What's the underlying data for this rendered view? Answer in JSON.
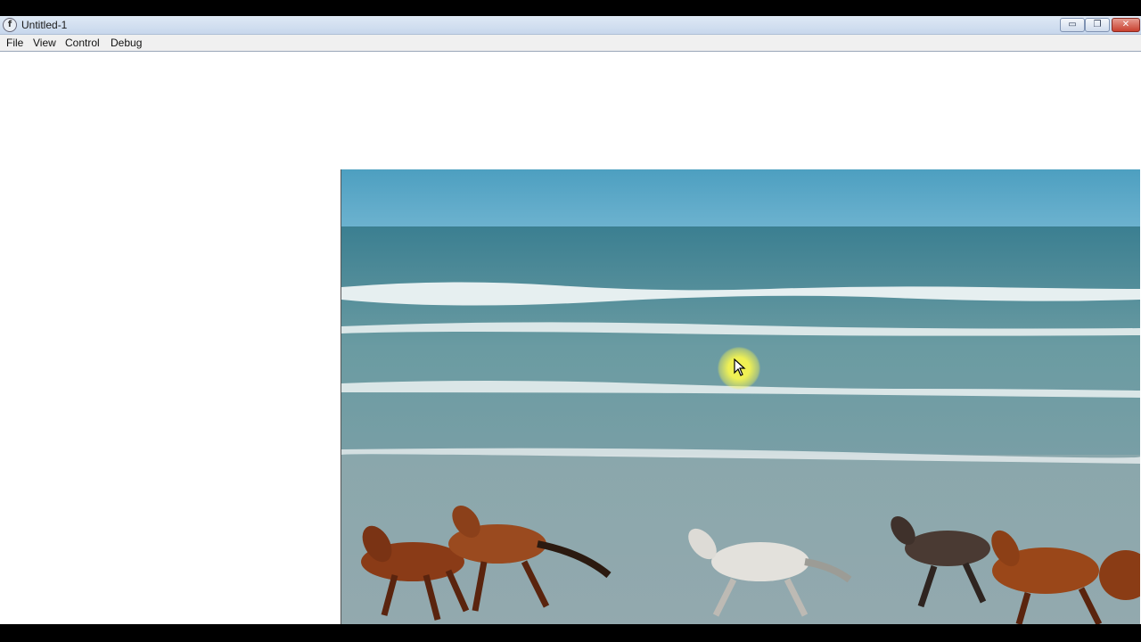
{
  "window": {
    "title": "Untitled-1",
    "controls": {
      "minimize": "▭",
      "maximize": "❐",
      "close": "✕"
    },
    "app_icon": "f"
  },
  "menubar": {
    "items": [
      "File",
      "View",
      "Control",
      "Debug"
    ]
  },
  "stage": {
    "video": {
      "description_icon": "video-frame-horses-beach"
    }
  },
  "colors": {
    "titlebar": "#c7d7ec",
    "menubar": "#f0f0f0",
    "sky": "#57a4c4",
    "sea": "#5f8f98",
    "sand": "#7f9ea4",
    "cursor_highlight": "#f6f550"
  }
}
